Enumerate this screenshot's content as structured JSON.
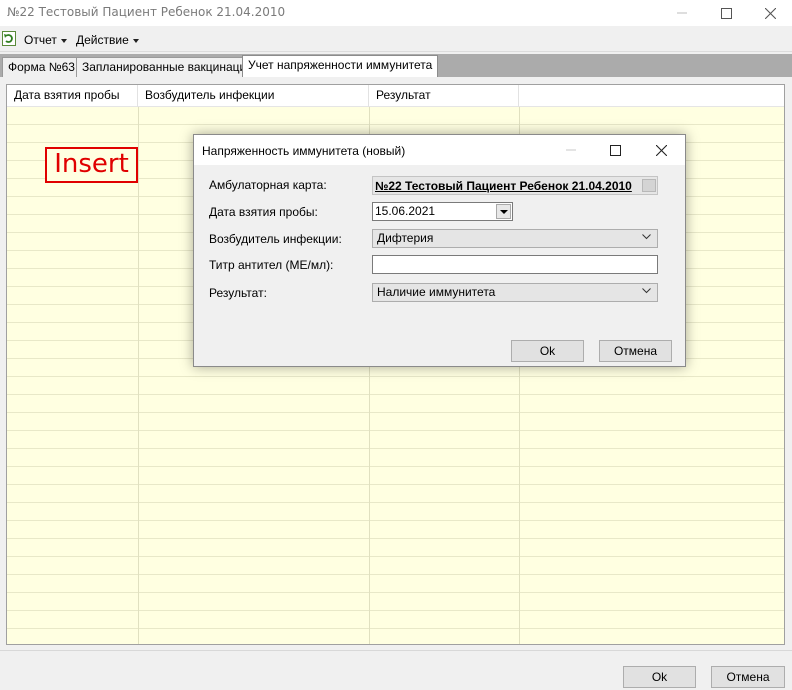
{
  "window": {
    "title": "№22 Тестовый Пациент Ребенок 21.04.2010"
  },
  "menu": {
    "report": "Отчет",
    "action": "Действие"
  },
  "tabs": [
    {
      "label": "Форма №63",
      "active": false
    },
    {
      "label": "Запланированные вакцинации",
      "active": false
    },
    {
      "label": "Учет напряженности иммунитета",
      "active": true
    }
  ],
  "grid": {
    "columns": [
      "Дата взятия пробы",
      "Возбудитель инфекции",
      "Результат",
      ""
    ]
  },
  "annotation": {
    "label": "Insert",
    "color": "#e00000"
  },
  "dialog": {
    "title": "Напряженность иммунитета (новый)",
    "fields": {
      "card": {
        "label": "Амбулаторная карта:",
        "value": "№22 Тестовый Пациент Ребенок 21.04.2010"
      },
      "date": {
        "label": "Дата взятия пробы:",
        "value": "15.06.2021"
      },
      "pathogen": {
        "label": "Возбудитель инфекции:",
        "value": "Дифтерия"
      },
      "titer": {
        "label": "Титр антител (МЕ/мл):",
        "value": ""
      },
      "result": {
        "label": "Результат:",
        "value": "Наличие иммунитета"
      }
    },
    "ok_label": "Ok",
    "cancel_label": "Отмена"
  },
  "footer": {
    "ok_label": "Ok",
    "cancel_label": "Отмена"
  },
  "colors": {
    "grid_background": "#ffffe1",
    "active_tab": "#ffffff"
  }
}
